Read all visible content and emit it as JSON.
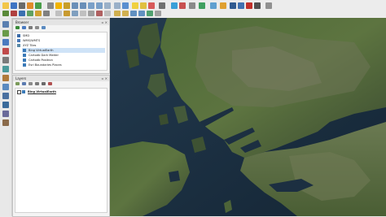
{
  "browser_panel": {
    "title": "Browser",
    "items": [
      {
        "label": "SMD",
        "icon": "folder-icon"
      },
      {
        "label": "WMS/WMTS",
        "icon": "wms-icon"
      },
      {
        "label": "XYZ Tiles",
        "icon": "xyz-tiles-icon"
      },
      {
        "label": "Bing VirtualEarth",
        "icon": "tile-layer-icon"
      },
      {
        "label": "Cartodb Dark Matter",
        "icon": "tile-layer-icon"
      },
      {
        "label": "Cartodb Positron",
        "icon": "tile-layer-icon"
      },
      {
        "label": "Esri Boundaries Places",
        "icon": "tile-layer-icon"
      }
    ]
  },
  "layers_panel": {
    "title": "Layers",
    "layers": [
      {
        "label": "Bing VirtualEarth",
        "checked": true
      }
    ]
  },
  "colors": {
    "toolbar_bg": "#ececec",
    "selection": "#cfe3f7",
    "sea": "#1c2f41",
    "land_green": "#4f6b38",
    "land_dark": "#3a4a30"
  }
}
